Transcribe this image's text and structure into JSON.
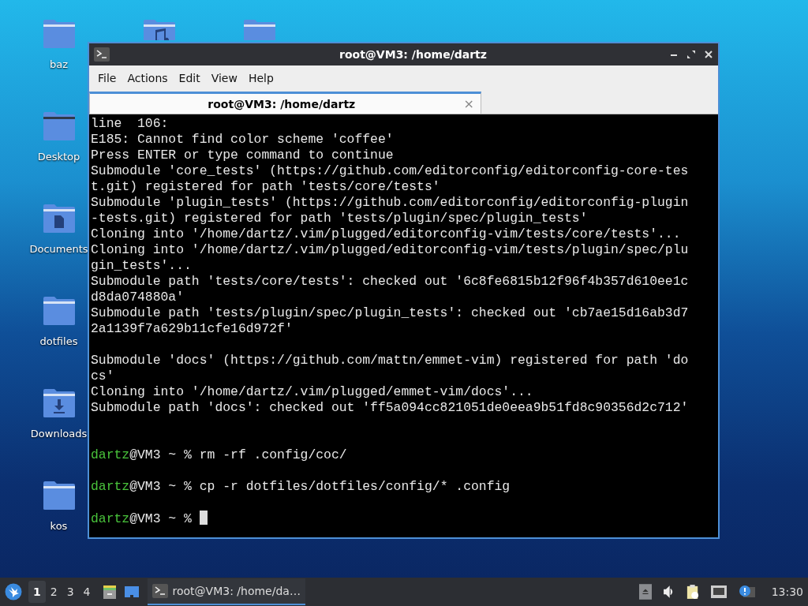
{
  "desktop": {
    "icons": [
      {
        "kind": "folder",
        "label": "baz"
      },
      {
        "kind": "music-folder"
      },
      {
        "kind": "folder"
      },
      {
        "kind": "desktop-folder",
        "label": "Desktop"
      },
      {
        "kind": "documents-folder",
        "label": "Documents"
      },
      {
        "kind": "folder",
        "label": "dotfiles"
      },
      {
        "kind": "downloads-folder",
        "label": "Downloads"
      },
      {
        "kind": "folder",
        "label": "kos"
      }
    ]
  },
  "window": {
    "title": "root@VM3: /home/dartz",
    "menu": [
      "File",
      "Actions",
      "Edit",
      "View",
      "Help"
    ],
    "tabs": [
      {
        "label": "root@VM3: /home/dartz",
        "selected": true,
        "close": "×"
      }
    ],
    "terminal": {
      "lines": [
        {
          "kind": "text",
          "text": "line  106:"
        },
        {
          "kind": "text",
          "text": "E185: Cannot find color scheme 'coffee'"
        },
        {
          "kind": "text",
          "text": "Press ENTER or type command to continue"
        },
        {
          "kind": "text",
          "text": "Submodule 'core_tests' (https://github.com/editorconfig/editorconfig-core-tes"
        },
        {
          "kind": "text",
          "text": "t.git) registered for path 'tests/core/tests'"
        },
        {
          "kind": "text",
          "text": "Submodule 'plugin_tests' (https://github.com/editorconfig/editorconfig-plugin"
        },
        {
          "kind": "text",
          "text": "-tests.git) registered for path 'tests/plugin/spec/plugin_tests'"
        },
        {
          "kind": "text",
          "text": "Cloning into '/home/dartz/.vim/plugged/editorconfig-vim/tests/core/tests'..."
        },
        {
          "kind": "text",
          "text": "Cloning into '/home/dartz/.vim/plugged/editorconfig-vim/tests/plugin/spec/plu"
        },
        {
          "kind": "text",
          "text": "gin_tests'..."
        },
        {
          "kind": "text",
          "text": "Submodule path 'tests/core/tests': checked out '6c8fe6815b12f96f4b357d610ee1c"
        },
        {
          "kind": "text",
          "text": "d8da074880a'"
        },
        {
          "kind": "text",
          "text": "Submodule path 'tests/plugin/spec/plugin_tests': checked out 'cb7ae15d16ab3d7"
        },
        {
          "kind": "text",
          "text": "2a1139f7a629b11cfe16d972f'"
        },
        {
          "kind": "blank"
        },
        {
          "kind": "text",
          "text": "Submodule 'docs' (https://github.com/mattn/emmet-vim) registered for path 'do"
        },
        {
          "kind": "text",
          "text": "cs'"
        },
        {
          "kind": "text",
          "text": "Cloning into '/home/dartz/.vim/plugged/emmet-vim/docs'..."
        },
        {
          "kind": "text",
          "text": "Submodule path 'docs': checked out 'ff5a094cc821051de0eea9b51fd8c90356d2c712'"
        },
        {
          "kind": "blank"
        },
        {
          "kind": "blank"
        },
        {
          "kind": "prompt",
          "user": "dartz",
          "rest": "@VM3 ~ % rm -rf .config/coc/"
        },
        {
          "kind": "blank"
        },
        {
          "kind": "prompt",
          "user": "dartz",
          "rest": "@VM3 ~ % cp -r dotfiles/dotfiles/config/* .config"
        },
        {
          "kind": "blank"
        },
        {
          "kind": "prompt",
          "user": "dartz",
          "rest": "@VM3 ~ %",
          "cursor": true
        }
      ]
    }
  },
  "taskbar": {
    "workspaces": [
      {
        "label": "1",
        "selected": true
      },
      {
        "label": "2",
        "selected": false
      },
      {
        "label": "3",
        "selected": false
      },
      {
        "label": "4",
        "selected": false
      }
    ],
    "tasks": [
      {
        "label": "root@VM3: /home/da…",
        "selected": true
      }
    ],
    "clock": "13:30"
  }
}
